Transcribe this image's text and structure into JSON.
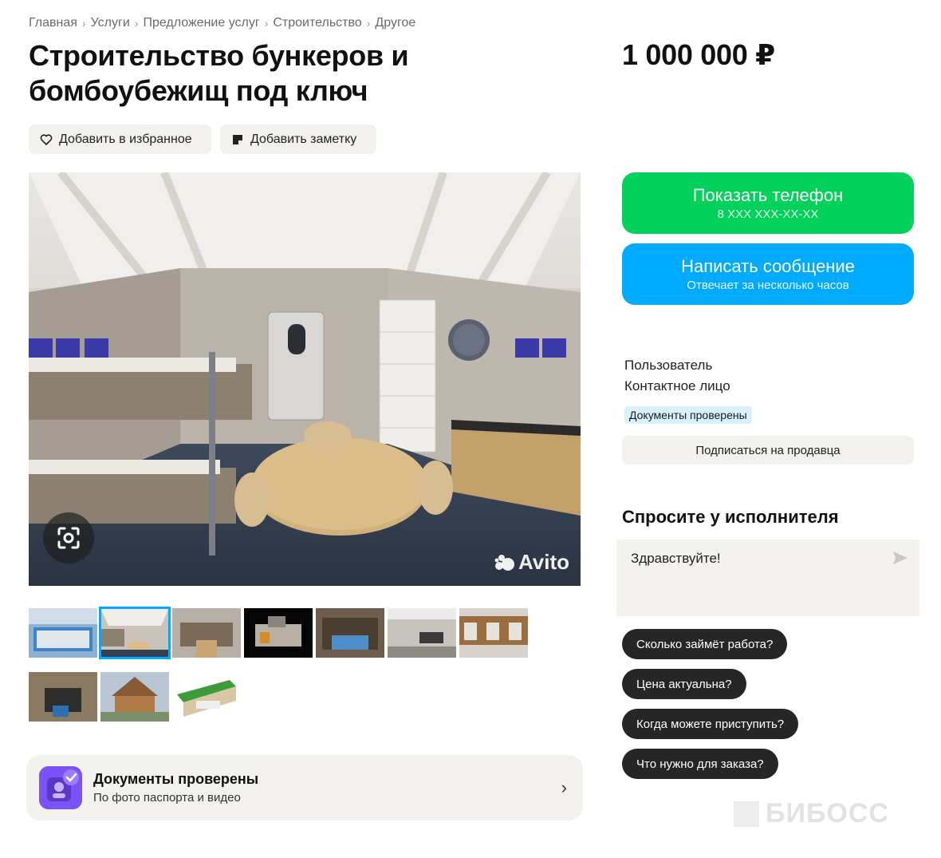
{
  "breadcrumb": [
    "Главная",
    "Услуги",
    "Предложение услуг",
    "Строительство",
    "Другое"
  ],
  "title": "Строительство бункеров и бомбоубежищ под ключ",
  "price": "1 000 000 ₽",
  "actions": {
    "favorite": "Добавить в избранное",
    "note": "Добавить заметку"
  },
  "photo": {
    "watermark": "Avito",
    "scan_icon": "lens-scan-icon"
  },
  "thumbnails": 10,
  "active_thumbnail": 1,
  "docs_card": {
    "title": "Документы проверены",
    "subtitle": "По фото паспорта и видео"
  },
  "contact": {
    "phone_label": "Показать телефон",
    "phone_masked": "8 XXX XXX-XX-XX",
    "message_label": "Написать сообщение",
    "message_sub": "Отвечает за несколько часов"
  },
  "seller": {
    "name": "Пользователь",
    "role": "Контактное лицо",
    "badge": "Документы проверены",
    "subscribe": "Подписаться на продавца"
  },
  "ask": {
    "title": "Спросите у исполнителя",
    "input_value": "Здравствуйте!",
    "chips": [
      "Сколько займёт работа?",
      "Цена актуальна?",
      "Когда можете приступить?",
      "Что нужно для заказа?"
    ]
  },
  "footer_logo": "БИБОСС",
  "colors": {
    "phone_btn": "#02d15c",
    "message_btn": "#00aaff",
    "chip_bg": "#262626",
    "card_bg": "#f2f1ee",
    "badge_bg": "#d9f0ff"
  }
}
